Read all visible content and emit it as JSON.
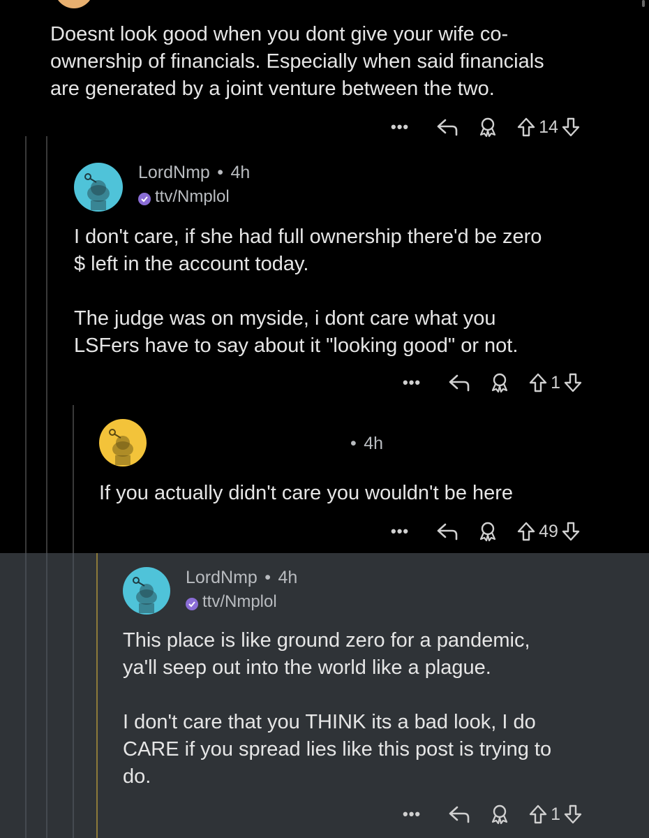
{
  "comments": [
    {
      "body": "Doesnt look good when you dont give your wife co-\nownership of financials. Especially when said financials\nare generated by a joint venture between the two.",
      "score": "14"
    },
    {
      "username": "LordNmp",
      "separator": "•",
      "time": "4h",
      "flair": "ttv/Nmplol",
      "body": "I don't care, if she had full ownership there'd be zero\n$ left in the account today.\n\nThe judge was on myside, i dont care what you\nLSFers have to say about it \"looking good\" or not.",
      "score": "1"
    },
    {
      "username": "",
      "separator": "•",
      "time": "4h",
      "body": "If you actually didn't care you wouldn't be here",
      "score": "49"
    },
    {
      "username": "LordNmp",
      "separator": "•",
      "time": "4h",
      "flair": "ttv/Nmplol",
      "body": "This place is like ground zero for a pandemic,\nya'll seep out into the world like a plague.\n\nI don't care that you THINK its a bad look, I do\nCARE if you spread lies like this post is trying to\ndo.",
      "score": "1"
    }
  ],
  "actions": {
    "more": "•••"
  },
  "colors": {
    "highlight_panel": "#2f3337",
    "highlight_line": "#8d7a3a",
    "avatar_teal": "#4fc3d9",
    "avatar_yellow": "#f3c33a",
    "verified_badge": "#8a6dd6"
  },
  "icons": [
    "more-icon",
    "reply-icon",
    "award-icon",
    "upvote-icon",
    "downvote-icon",
    "snoo-avatar-icon",
    "verified-icon"
  ]
}
